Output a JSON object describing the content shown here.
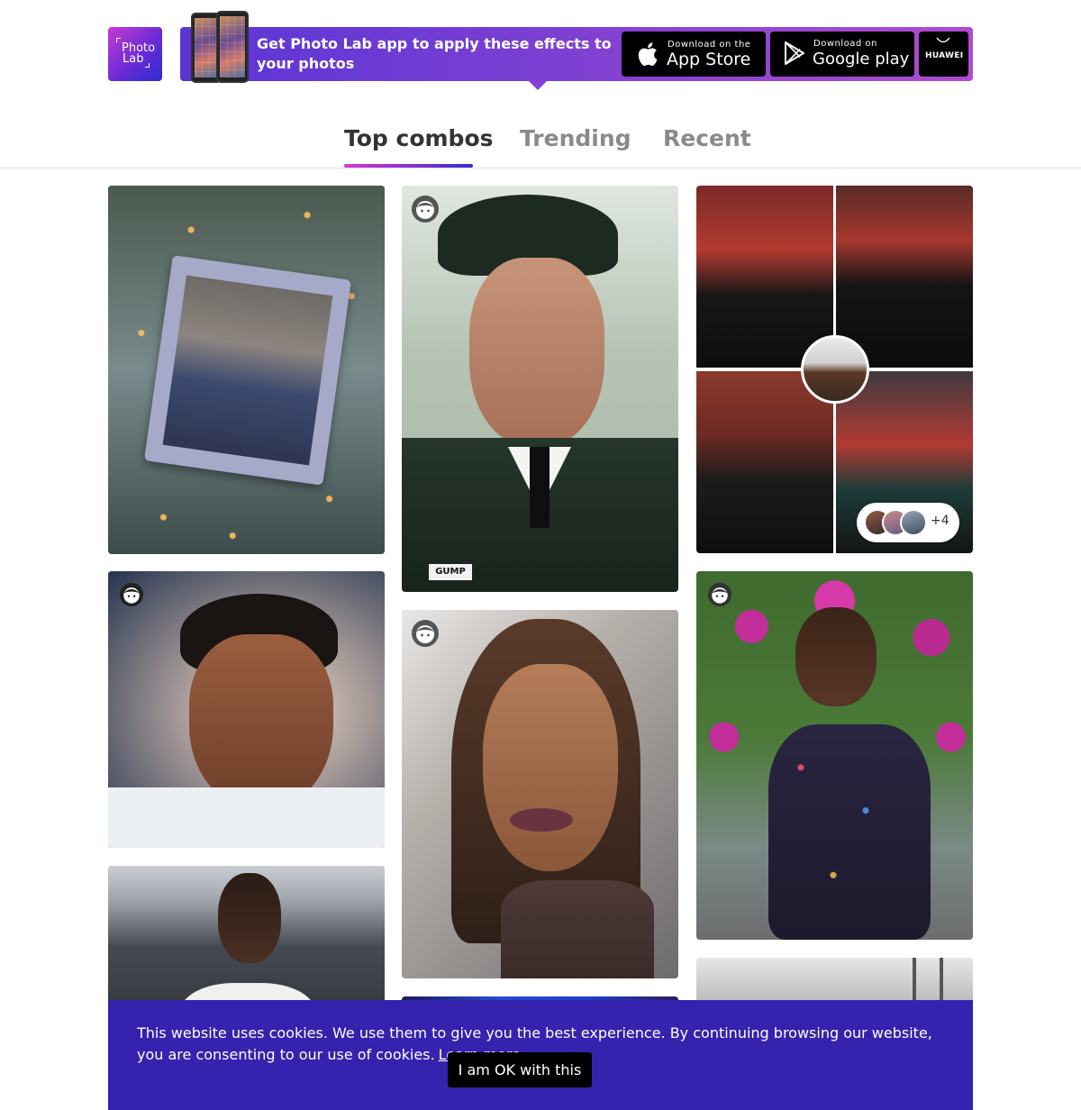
{
  "header": {
    "logo": {
      "line1": "Photo",
      "line2": "Lab"
    },
    "promo_text": "Get Photo Lab app to apply these effects to your photos",
    "stores": {
      "appstore": {
        "small": "Download on the",
        "big": "App Store",
        "icon": "apple-icon"
      },
      "googleplay": {
        "small": "Download on",
        "big": "Google play",
        "icon": "google-play-icon"
      },
      "huawei": {
        "label": "HUAWEI",
        "icon": "huawei-icon"
      }
    }
  },
  "tabs": [
    {
      "label": "Top combos",
      "active": true
    },
    {
      "label": "Trending",
      "active": false
    },
    {
      "label": "Recent",
      "active": false
    }
  ],
  "grid": {
    "cards": [
      {
        "subject": "couple-in-winter-frame"
      },
      {
        "subject": "soldier-portrait",
        "badge": "face-icon"
      },
      {
        "subject": "red-carpet-collage",
        "more_count": "+4"
      },
      {
        "subject": "boy-painted-portrait",
        "badge": "face-icon"
      },
      {
        "subject": "woman-painted-portrait",
        "badge": "face-icon"
      },
      {
        "subject": "woman-flowers-sparkle",
        "badge": "face-icon"
      },
      {
        "subject": "woman-braids"
      },
      {
        "subject": "blue-neon"
      },
      {
        "subject": "monochrome-building"
      }
    ]
  },
  "cookie": {
    "text": "This website uses cookies. We use them to give you the best experience. By continuing browsing our website, you are consenting to our use of cookies.",
    "link": "Learn more",
    "button": "I am OK with this"
  },
  "colors": {
    "accent_gradient_start": "#d63ad0",
    "accent_gradient_end": "#3a2bd0",
    "cookie_bg": "#3522ae"
  }
}
